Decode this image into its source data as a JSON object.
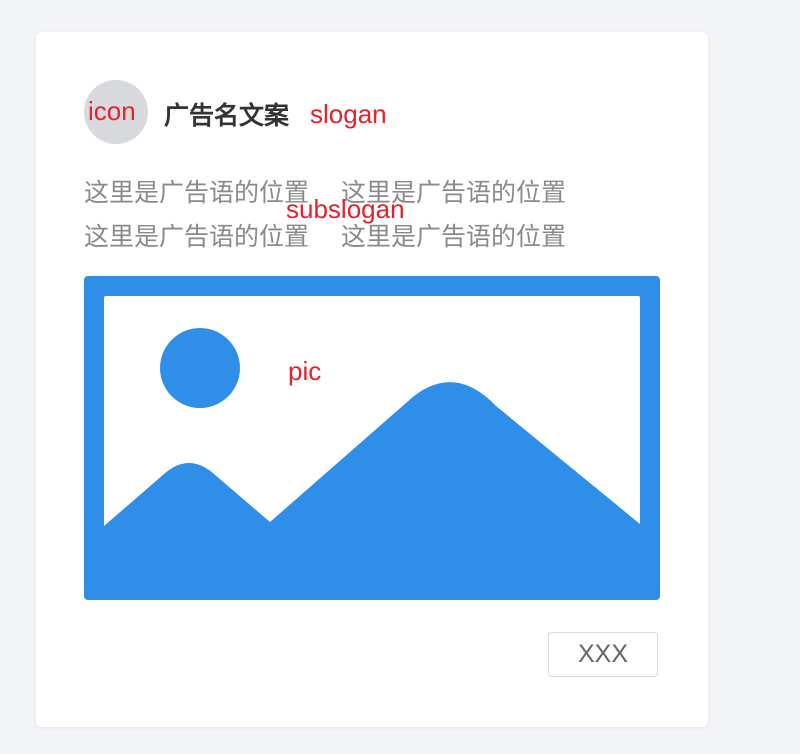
{
  "annotations": {
    "icon": "icon",
    "slogan": "slogan",
    "subslogan": "subslogan",
    "pic": "pic"
  },
  "ad": {
    "title": "广告名文案",
    "subslogan_lines": [
      [
        "这里是广告语的位置",
        "这里是广告语的位置"
      ],
      [
        "这里是广告语的位置",
        "这里是广告语的位置"
      ]
    ],
    "image_icon": "image-placeholder-icon",
    "button_label": "XXX"
  },
  "colors": {
    "annotation": "#e8202a",
    "image_fill": "#2f8fe8",
    "avatar": "#d7d9dd"
  }
}
